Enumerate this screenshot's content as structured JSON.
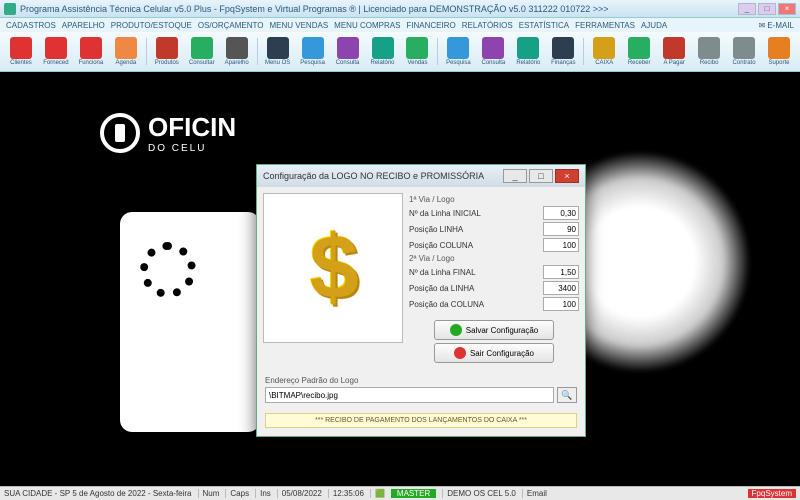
{
  "window": {
    "title": "Programa Assistência Técnica Celular v5.0 Plus - FpqSystem e Virtual Programas ® | Licenciado para  DEMONSTRAÇÃO v5.0 311222 010722 >>>"
  },
  "menu": {
    "items": [
      "CADASTROS",
      "APARELHO",
      "PRODUTO/ESTOQUE",
      "OS/ORÇAMENTO",
      "MENU VENDAS",
      "MENU COMPRAS",
      "FINANCEIRO",
      "RELATÓRIOS",
      "ESTATÍSTICA",
      "FERRAMENTAS",
      "AJUDA"
    ],
    "email": "E-MAIL"
  },
  "toolbar": {
    "buttons": [
      {
        "label": "Clientes",
        "color": "#d33"
      },
      {
        "label": "Forneced",
        "color": "#d33"
      },
      {
        "label": "Funciona",
        "color": "#d33"
      },
      {
        "label": "Agenda",
        "color": "#e84"
      },
      {
        "label": "Produtos",
        "color": "#c0392b"
      },
      {
        "label": "Consultar",
        "color": "#27ae60"
      },
      {
        "label": "Aparelho",
        "color": "#555"
      },
      {
        "label": "Menu OS",
        "color": "#2c3e50"
      },
      {
        "label": "Pesquisa",
        "color": "#3498db"
      },
      {
        "label": "Consulta",
        "color": "#8e44ad"
      },
      {
        "label": "Relatório",
        "color": "#16a085"
      },
      {
        "label": "Vendas",
        "color": "#27ae60"
      },
      {
        "label": "Pesquisa",
        "color": "#3498db"
      },
      {
        "label": "Consulta",
        "color": "#8e44ad"
      },
      {
        "label": "Relatório",
        "color": "#16a085"
      },
      {
        "label": "Finanças",
        "color": "#2c3e50"
      },
      {
        "label": "CAIXA",
        "color": "#d4a017"
      },
      {
        "label": "Receber",
        "color": "#27ae60"
      },
      {
        "label": "A Pagar",
        "color": "#c0392b"
      },
      {
        "label": "Recibo",
        "color": "#7f8c8d"
      },
      {
        "label": "Contrato",
        "color": "#7f8c8d"
      },
      {
        "label": "Suporte",
        "color": "#e67e22"
      }
    ]
  },
  "bg": {
    "title": "OFICIN",
    "sub": "DO CELU"
  },
  "dialog": {
    "title": "Configuração da LOGO NO RECIBO e PROMISSÓRIA",
    "via1": {
      "head": "1ª Via / Logo",
      "f1": {
        "label": "Nº da Linha INICIAL",
        "value": "0,30"
      },
      "f2": {
        "label": "Posição LINHA",
        "value": "90"
      },
      "f3": {
        "label": "Posição COLUNA",
        "value": "100"
      }
    },
    "via2": {
      "head": "2ª Via / Logo",
      "f1": {
        "label": "Nº da Linha FINAL",
        "value": "1,50"
      },
      "f2": {
        "label": "Posição da LINHA",
        "value": "3400"
      },
      "f3": {
        "label": "Posição da COLUNA",
        "value": "100"
      }
    },
    "btn_save": "Salvar Configuração",
    "btn_exit": "Sair Configuração",
    "path_label": "Endereço Padrão do Logo",
    "path_value": "\\BITMAP\\recibo.jpg",
    "footer": "*** RECIBO DE PAGAMENTO DOS LANÇAMENTOS DO CAIXA ***"
  },
  "status": {
    "city": "SUA CIDADE - SP  5 de Agosto de 2022 - Sexta-feira",
    "num": "Num",
    "caps": "Caps",
    "ins": "Ins",
    "date": "05/08/2022",
    "time": "12:35:06",
    "master": "MASTER",
    "demo": "DEMO OS CEL 5.0",
    "email": "Email",
    "fpq": "FpqSystem"
  }
}
